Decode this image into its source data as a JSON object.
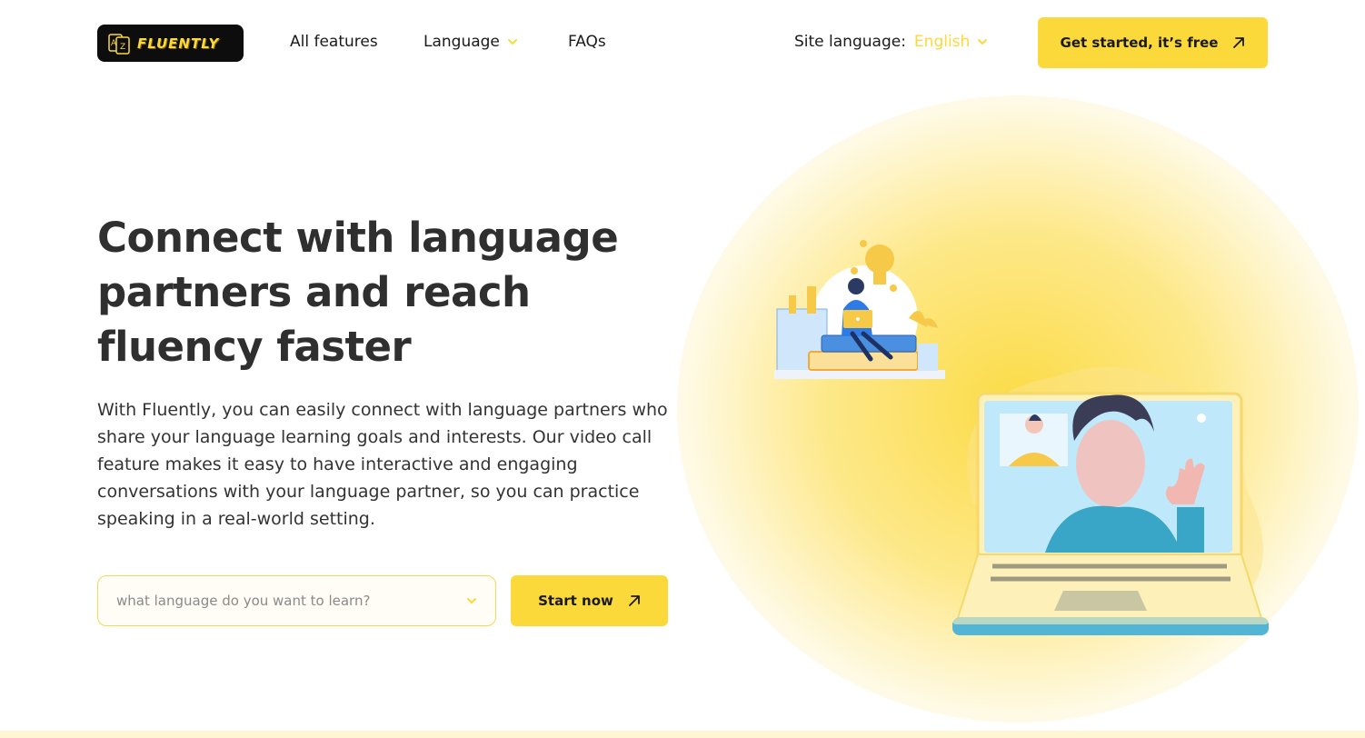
{
  "header": {
    "logo_text": "FLUENTLY",
    "nav": {
      "features": "All features",
      "language": "Language",
      "faqs": "FAQs"
    },
    "site_language_label": "Site language:",
    "site_language_value": "English",
    "cta": "Get started, it’s free"
  },
  "hero": {
    "title": "Connect with language partners and reach fluency faster",
    "description": "With Fluently, you can easily connect with language partners who share your language learning goals and interests. Our video call feature makes it easy to have interactive and engaging conversations with your language partner, so you can practice speaking in a real-world setting.",
    "select_placeholder": "what language do you want to learn?",
    "start_button": "Start now"
  },
  "colors": {
    "accent": "#fcd93b",
    "text": "#2f2f2f"
  },
  "icons": [
    "logo-mark-icon",
    "chevron-down-icon",
    "arrow-up-right-icon",
    "study-illustration",
    "video-call-illustration"
  ]
}
